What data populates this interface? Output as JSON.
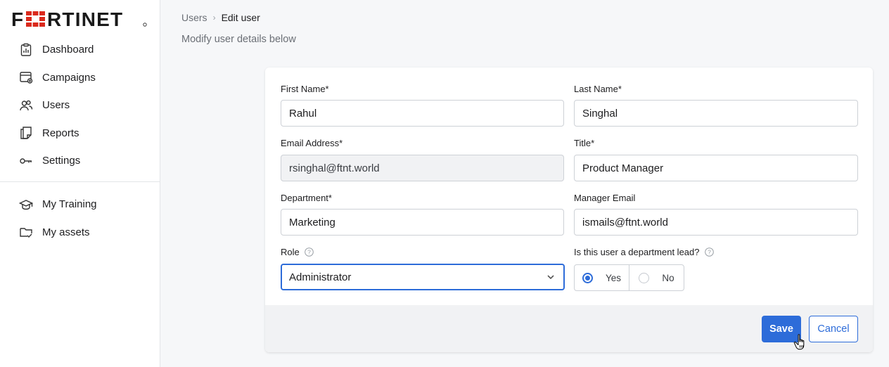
{
  "brand": {
    "logo_text": "FORTINET",
    "logo_color": "#1a1a1a",
    "accent_red": "#da291c"
  },
  "sidebar": {
    "items": [
      {
        "label": "Dashboard",
        "icon": "clipboard-chart-icon"
      },
      {
        "label": "Campaigns",
        "icon": "campaign-window-icon"
      },
      {
        "label": "Users",
        "icon": "users-icon"
      },
      {
        "label": "Reports",
        "icon": "reports-icon"
      },
      {
        "label": "Settings",
        "icon": "key-settings-icon"
      }
    ],
    "secondary_items": [
      {
        "label": "My Training",
        "icon": "graduation-cap-icon"
      },
      {
        "label": "My assets",
        "icon": "folder-check-icon"
      }
    ]
  },
  "breadcrumb": {
    "parent": "Users",
    "separator": "›",
    "current": "Edit user"
  },
  "page": {
    "subtitle": "Modify user details below"
  },
  "form": {
    "first_name": {
      "label": "First Name*",
      "value": "Rahul"
    },
    "last_name": {
      "label": "Last Name*",
      "value": "Singhal"
    },
    "email": {
      "label": "Email Address*",
      "value": "rsinghal@ftnt.world"
    },
    "title": {
      "label": "Title*",
      "value": "Product Manager"
    },
    "department": {
      "label": "Department*",
      "value": "Marketing"
    },
    "manager_email": {
      "label": "Manager Email",
      "value": "ismails@ftnt.world"
    },
    "role": {
      "label": "Role",
      "value": "Administrator"
    },
    "department_lead": {
      "label": "Is this user a department lead?",
      "options": [
        "Yes",
        "No"
      ],
      "selected": "Yes"
    }
  },
  "actions": {
    "save_label": "Save",
    "cancel_label": "Cancel"
  },
  "colors": {
    "primary": "#2d6cd9"
  }
}
